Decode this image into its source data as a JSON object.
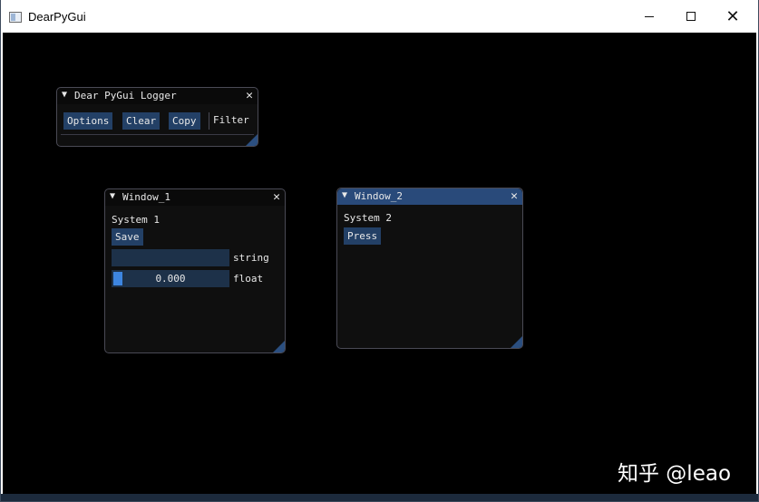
{
  "app": {
    "title": "DearPyGui"
  },
  "logger": {
    "title": "Dear PyGui Logger",
    "buttons": {
      "options": "Options",
      "clear": "Clear",
      "copy": "Copy"
    },
    "filter_label": "Filter"
  },
  "window1": {
    "title": "Window_1",
    "text": "System 1",
    "save_label": "Save",
    "string_input": {
      "value": "",
      "label": "string"
    },
    "float_slider": {
      "value": "0.000",
      "label": "float",
      "fraction": 0.0
    }
  },
  "window2": {
    "title": "Window_2",
    "text": "System 2",
    "press_label": "Press"
  },
  "watermark": {
    "text": "知乎 @leao"
  },
  "icons": {
    "collapse": "triangle-down-icon",
    "close": "close-icon",
    "resize": "resize-grip-icon"
  },
  "colors": {
    "background": "#000000",
    "window_bg": "#0f0f0f",
    "active_title": "#294a7a",
    "button": "#234066",
    "frame": "#1d3149",
    "slider_grab": "#3d85e0"
  }
}
